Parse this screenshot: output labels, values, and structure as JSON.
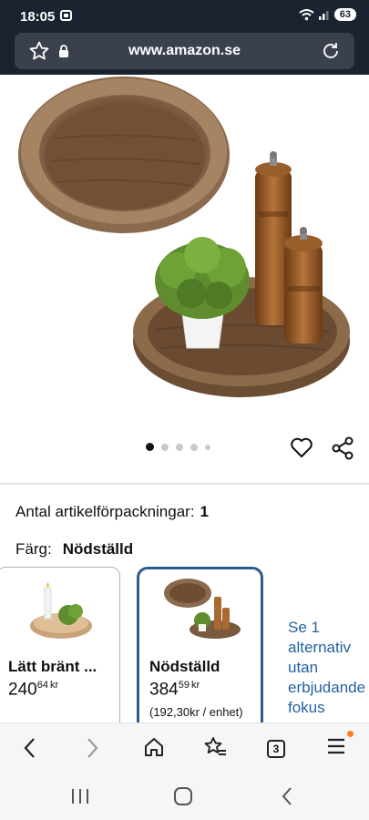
{
  "status": {
    "time": "18:05",
    "battery": "63"
  },
  "browser": {
    "url": "www.amazon.se",
    "tabs_count": "3"
  },
  "product": {
    "quantity_label": "Antal artikelförpackningar:",
    "quantity_value": "1",
    "color_label": "Färg:",
    "color_value": "Nödställd",
    "image_count": 5,
    "active_image": 1
  },
  "variants": [
    {
      "title": "Lätt bränt ...",
      "price_whole": "240",
      "price_fraction": "64",
      "currency": "kr",
      "unit_price": ""
    },
    {
      "title": "Nödställd",
      "price_whole": "384",
      "price_fraction": "59",
      "currency": "kr",
      "unit_price": "(192,30kr / enhet)"
    }
  ],
  "see_alternatives": [
    "Se 1",
    "alternativ",
    "utan",
    "erbjudande",
    "fokus"
  ],
  "icons": {
    "wishlist": "heart-icon",
    "share": "share-icon",
    "back": "back-arrow-icon",
    "forward": "forward-arrow-icon",
    "home": "home-icon",
    "bookmarks": "star-list-icon",
    "tabs": "tabs-icon",
    "menu": "menu-icon"
  },
  "colors": {
    "accent_blue": "#2a5c8f",
    "link_blue": "#2162a1",
    "notification": "#ff7a20"
  }
}
